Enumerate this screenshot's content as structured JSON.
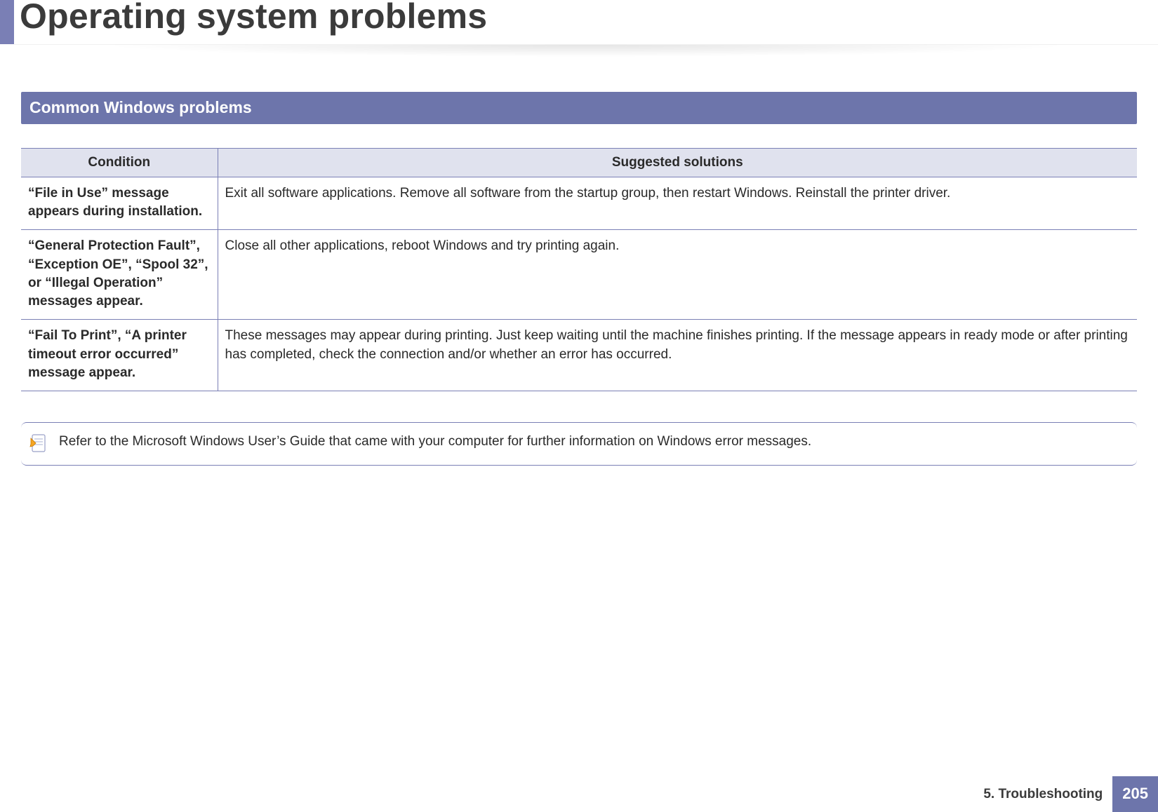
{
  "page": {
    "title": "Operating system problems",
    "section_title": "Common Windows problems"
  },
  "table": {
    "headers": {
      "condition": "Condition",
      "solutions": "Suggested solutions"
    },
    "rows": [
      {
        "condition": "“File in Use” message appears during installation.",
        "solution": "Exit all software applications. Remove all software from the startup group, then restart Windows. Reinstall the printer driver."
      },
      {
        "condition": "“General Protection Fault”, “Exception OE”, “Spool 32”, or “Illegal Operation” messages appear.",
        "solution": "Close all other applications, reboot Windows and try printing again."
      },
      {
        "condition": "“Fail To Print”, “A printer timeout error occurred” message appear.",
        "solution": "These messages may appear during printing. Just keep waiting until the machine finishes printing. If the message appears in ready mode or after printing has completed, check the connection and/or whether an error has occurred."
      }
    ]
  },
  "note": {
    "text": "Refer to the Microsoft Windows User’s Guide that came with your computer for further information on Windows error messages."
  },
  "footer": {
    "chapter": "5.  Troubleshooting",
    "page_number": "205"
  }
}
